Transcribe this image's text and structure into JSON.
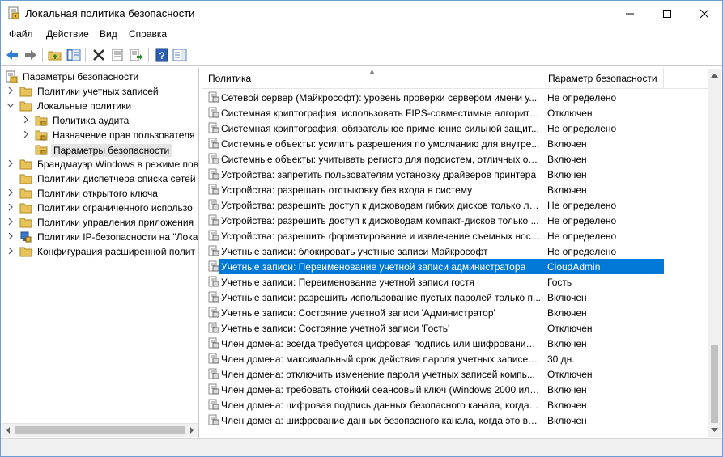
{
  "window": {
    "title": "Локальная политика безопасности"
  },
  "menu": {
    "file": "Файл",
    "action": "Действие",
    "view": "Вид",
    "help": "Справка"
  },
  "tree": {
    "root": "Параметры безопасности",
    "items": [
      {
        "label": "Политики учетных записей"
      },
      {
        "label": "Локальные политики"
      },
      {
        "label": "Политика аудита"
      },
      {
        "label": "Назначение прав пользователя"
      },
      {
        "label": "Параметры безопасности"
      },
      {
        "label": "Брандмауэр Windows в режиме пов"
      },
      {
        "label": "Политики диспетчера списка сетей"
      },
      {
        "label": "Политики открытого ключа"
      },
      {
        "label": "Политики ограниченного использо"
      },
      {
        "label": "Политики управления приложения"
      },
      {
        "label": "Политики IP-безопасности на \"Лока"
      },
      {
        "label": "Конфигурация расширенной полит"
      }
    ]
  },
  "list": {
    "columns": [
      "Политика",
      "Параметр безопасности"
    ],
    "rows": [
      {
        "policy": "Сетевой сервер (Майкрософт): уровень проверки сервером имени у...",
        "value": "Не определено"
      },
      {
        "policy": "Системная криптография: использовать FIPS-совместимые алгоритм...",
        "value": "Отключен"
      },
      {
        "policy": "Системная криптография: обязательное применение сильной защит...",
        "value": "Не определено"
      },
      {
        "policy": "Системные объекты: усилить разрешения по умолчанию для внутре...",
        "value": "Включен"
      },
      {
        "policy": "Системные объекты: учитывать регистр для подсистем, отличных от ...",
        "value": "Включен"
      },
      {
        "policy": "Устройства: запретить пользователям установку драйверов принтера",
        "value": "Включен"
      },
      {
        "policy": "Устройства: разрешать отстыковку без входа в систему",
        "value": "Включен"
      },
      {
        "policy": "Устройства: разрешить доступ к дисководам гибких дисков только ло...",
        "value": "Не определено"
      },
      {
        "policy": "Устройства: разрешить доступ к дисководам компакт-дисков только ...",
        "value": "Не определено"
      },
      {
        "policy": "Устройства: разрешить форматирование и извлечение съемных носи...",
        "value": "Не определено"
      },
      {
        "policy": "Учетные записи: блокировать учетные записи Майкрософт",
        "value": "Не определено"
      },
      {
        "policy": "Учетные записи: Переименование учетной записи администратора",
        "value": "CloudAdmin"
      },
      {
        "policy": "Учетные записи: Переименование учетной записи гостя",
        "value": "Гость"
      },
      {
        "policy": "Учетные записи: разрешить использование пустых паролей только п...",
        "value": "Включен"
      },
      {
        "policy": "Учетные записи: Состояние учетной записи 'Администратор'",
        "value": "Включен"
      },
      {
        "policy": "Учетные записи: Состояние учетной записи 'Гость'",
        "value": "Отключен"
      },
      {
        "policy": "Член домена: всегда требуется цифровая подпись или шифрование ...",
        "value": "Включен"
      },
      {
        "policy": "Член домена: максимальный срок действия пароля учетных записей ...",
        "value": "30 дн."
      },
      {
        "policy": "Член домена: отключить изменение пароля учетных записей компь...",
        "value": "Отключен"
      },
      {
        "policy": "Член домена: требовать стойкий сеансовый ключ (Windows 2000 или...",
        "value": "Включен"
      },
      {
        "policy": "Член домена: цифровая подпись данных безопасного канала, когда э...",
        "value": "Включен"
      },
      {
        "policy": "Член домена: шифрование данных безопасного канала, когда это воз...",
        "value": "Включен"
      }
    ]
  },
  "colors": {
    "selection": "#0078d7",
    "folder": "#e8c25a"
  }
}
